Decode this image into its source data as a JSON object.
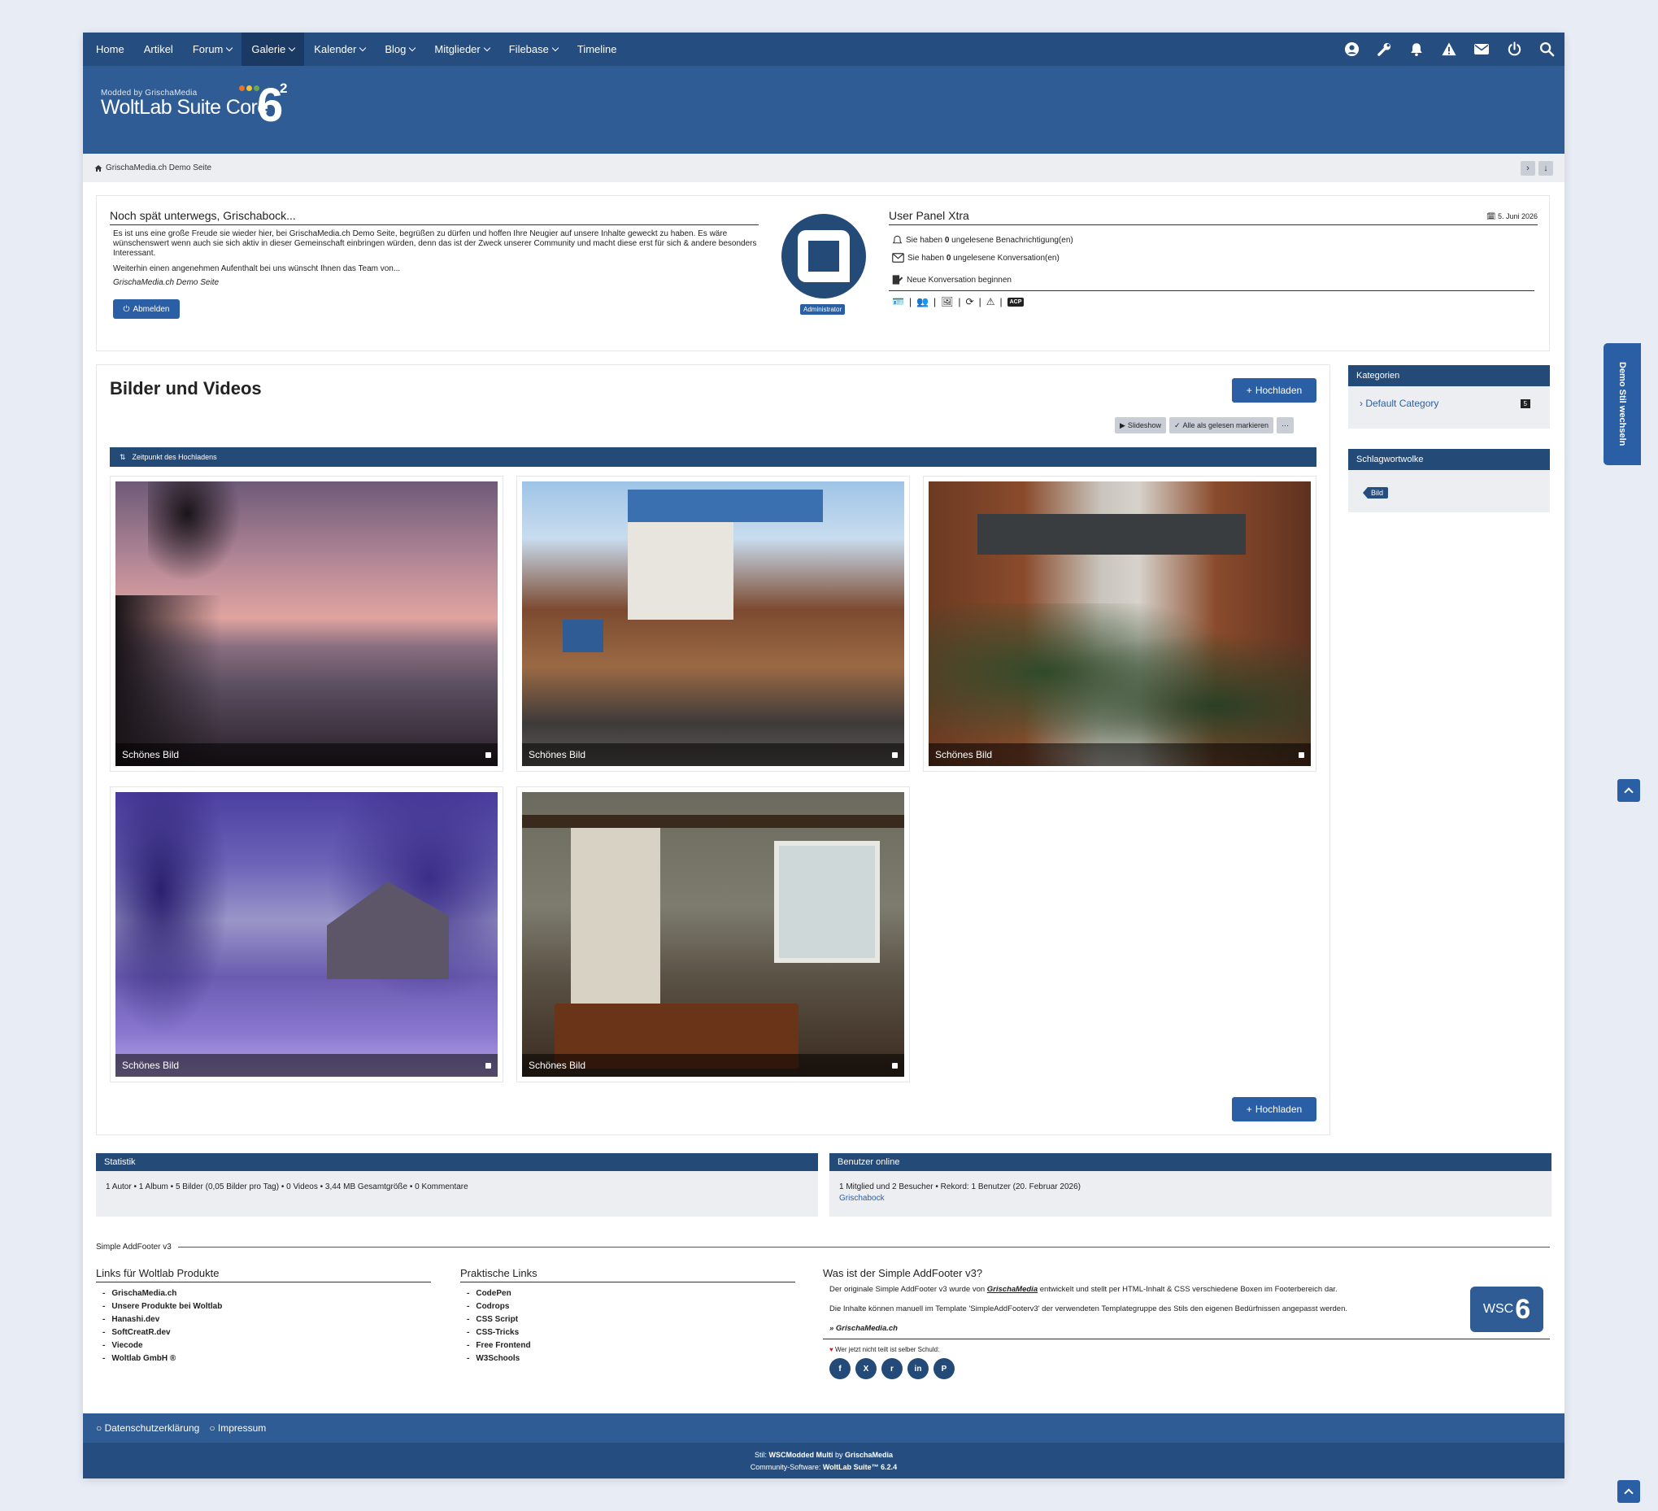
{
  "nav": {
    "items": [
      {
        "label": "Home",
        "dropdown": false,
        "active": false
      },
      {
        "label": "Artikel",
        "dropdown": false,
        "active": false
      },
      {
        "label": "Forum",
        "dropdown": true,
        "active": false
      },
      {
        "label": "Galerie",
        "dropdown": true,
        "active": true
      },
      {
        "label": "Kalender",
        "dropdown": true,
        "active": false
      },
      {
        "label": "Blog",
        "dropdown": true,
        "active": false
      },
      {
        "label": "Mitglieder",
        "dropdown": true,
        "active": false
      },
      {
        "label": "Filebase",
        "dropdown": true,
        "active": false
      },
      {
        "label": "Timeline",
        "dropdown": false,
        "active": false
      }
    ],
    "icons": [
      "user-icon",
      "wrench-icon",
      "bell-icon",
      "warning-icon",
      "envelope-icon",
      "power-icon",
      "search-icon"
    ]
  },
  "logo": {
    "small": "Modded by GrischaMedia",
    "big": "WoltLab Suite Core",
    "six": "6",
    "sq": "2"
  },
  "breadcrumb": {
    "home": "GrischaMedia.ch Demo Seite"
  },
  "welcome": {
    "title": "Noch spät unterwegs, Grischabock...",
    "p1": "Es ist uns eine große Freude sie wieder hier, bei GrischaMedia.ch Demo Seite, begrüßen zu dürfen und hoffen Ihre Neugier auf unsere Inhalte geweckt zu haben. Es wäre wünschenswert wenn auch sie sich aktiv in dieser Gemeinschaft einbringen würden, denn das ist der Zweck unserer Community und macht diese erst für sich & andere besonders Interessant.",
    "p2": "Weiterhin einen angenehmen Aufenthalt bei uns wünscht Ihnen das Team von...",
    "sig": "GrischaMedia.ch Demo Seite",
    "logout": "Abmelden",
    "badge": "Administrator"
  },
  "userpanel": {
    "title": "User Panel Xtra",
    "date": "5. Juni 2026",
    "notif_pre": "Sie haben ",
    "notif_count": "0",
    "notif_post": " ungelesene Benachrichtigung(en)",
    "conv_pre": "Sie haben ",
    "conv_count": "0",
    "conv_post": " ungelesene Konversation(en)",
    "new_conv": "Neue Konversation beginnen",
    "acp": "ACP"
  },
  "gallery": {
    "title": "Bilder und Videos",
    "upload": "Hochladen",
    "slideshow": "Slideshow",
    "mark_read": "Alle als gelesen markieren",
    "more": "···",
    "sort": "Zeitpunkt des Hochladens",
    "items": [
      {
        "caption": "Schönes Bild"
      },
      {
        "caption": "Schönes Bild"
      },
      {
        "caption": "Schönes Bild"
      },
      {
        "caption": "Schönes Bild"
      },
      {
        "caption": "Schönes Bild"
      }
    ]
  },
  "sidebar": {
    "categories_title": "Kategorien",
    "category": "Default Category",
    "category_count": "5",
    "tags_title": "Schlagwortwolke",
    "tag": "Bild"
  },
  "stats": {
    "title": "Statistik",
    "text": "1 Autor • 1 Album • 5 Bilder (0,05 Bilder pro Tag) • 0 Videos • 3,44 MB Gesamtgröße • 0 Kommentare"
  },
  "online": {
    "title": "Benutzer online",
    "text": "1 Mitglied und 2 Besucher • Rekord: 1 Benutzer (20. Februar 2026)",
    "user": "Grischabock"
  },
  "addfooter": {
    "heading": "Simple AddFooter v3",
    "col1_title": "Links für Woltlab Produkte",
    "col1": [
      "GrischaMedia.ch",
      "Unsere Produkte bei Woltlab",
      "Hanashi.dev",
      "SoftCreatR.dev",
      "Viecode",
      "Woltlab GmbH ®"
    ],
    "col2_title": "Praktische Links",
    "col2": [
      "CodePen",
      "Codrops",
      "CSS Script",
      "CSS-Tricks",
      "Free Frontend",
      "W3Schools"
    ],
    "col3_title": "Was ist der Simple AddFooter v3?",
    "col3_p1_pre": "Der originale Simple AddFooter v3 wurde von ",
    "col3_p1_brand": "GrischaMedia",
    "col3_p1_post": " entwickelt und stellt per HTML-Inhalt & CSS verschiedene Boxen im Footerbereich dar.",
    "col3_p2": "Die Inhalte können manuell im Template 'SimpleAddFooterv3' der verwendeten Templategruppe des Stils den eigenen Bedürfnissen angepasst werden.",
    "col3_link": "» GrischaMedia.ch",
    "share": "Wer jetzt nicht teilt ist selber Schuld:",
    "wsc_logo": "WSC",
    "socials": [
      "facebook",
      "x",
      "reddit",
      "linkedin",
      "pinterest"
    ]
  },
  "footer": {
    "privacy": "Datenschutzerklärung",
    "imprint": "Impressum",
    "style_pre": "Stil: ",
    "style_name": "WSCModded Multi",
    "style_by": " by ",
    "style_author": "GrischaMedia",
    "software_pre": "Community-Software: ",
    "software": "WoltLab Suite™ 6.2.4"
  },
  "demo_tab": "Demo Stil wechseln",
  "colors": {
    "primary": "#254d80",
    "banner": "#2f5c94",
    "button": "#2a5fa6"
  }
}
